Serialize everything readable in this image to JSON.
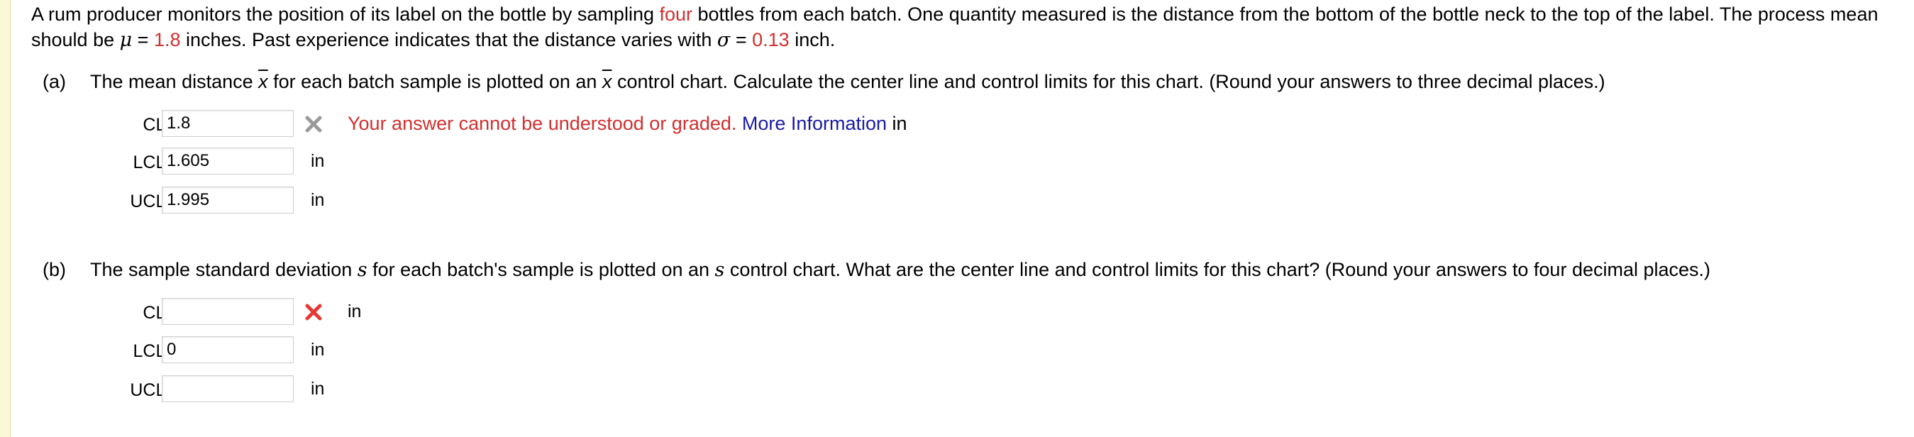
{
  "intro": {
    "t1": "A rum producer monitors the position of its label on the bottle by sampling ",
    "sample_word": "four",
    "t2": " bottles from each batch. One quantity measured is the distance from the bottom of the bottle neck to the top of the label. The process mean should be ",
    "mu_sym": "μ",
    "eq1": " = ",
    "mu_val": "1.8",
    "t3": " inches. Past experience indicates that the distance varies with ",
    "sigma_sym": "σ",
    "eq2": " = ",
    "sigma_val": "0.13",
    "t4": " inch."
  },
  "part_a": {
    "label": "(a)",
    "q1": "The mean distance ",
    "xbar": "x",
    "q2": " for each batch sample is plotted on an ",
    "q3": " control chart. Calculate the center line and control limits for this chart. (Round your answers to three decimal places.)",
    "rows": [
      {
        "label": "CL =",
        "value": "1.8",
        "unit": "in",
        "status": "gray-x",
        "feedback": "Your answer cannot be understood or graded.",
        "more_info": "More Information"
      },
      {
        "label": "LCL =",
        "value": "1.605",
        "unit": "in",
        "status": ""
      },
      {
        "label": "UCL =",
        "value": "1.995",
        "unit": "in",
        "status": ""
      }
    ]
  },
  "part_b": {
    "label": "(b)",
    "q1": "The sample standard deviation ",
    "s": "s",
    "q2": " for each batch's sample is plotted on an ",
    "q3": " control chart. What are the center line and control limits for this chart? (Round your answers to four decimal places.)",
    "rows": [
      {
        "label": "CL =",
        "value": "",
        "unit": "in",
        "status": "red-x"
      },
      {
        "label": "LCL =",
        "value": "0",
        "unit": "in",
        "status": ""
      },
      {
        "label": "UCL =",
        "value": "",
        "unit": "in",
        "status": ""
      }
    ]
  },
  "colors": {
    "accent_red": "#d32f2f",
    "link_blue": "#1a1aa6",
    "gray_x": "#9a9a9a"
  }
}
